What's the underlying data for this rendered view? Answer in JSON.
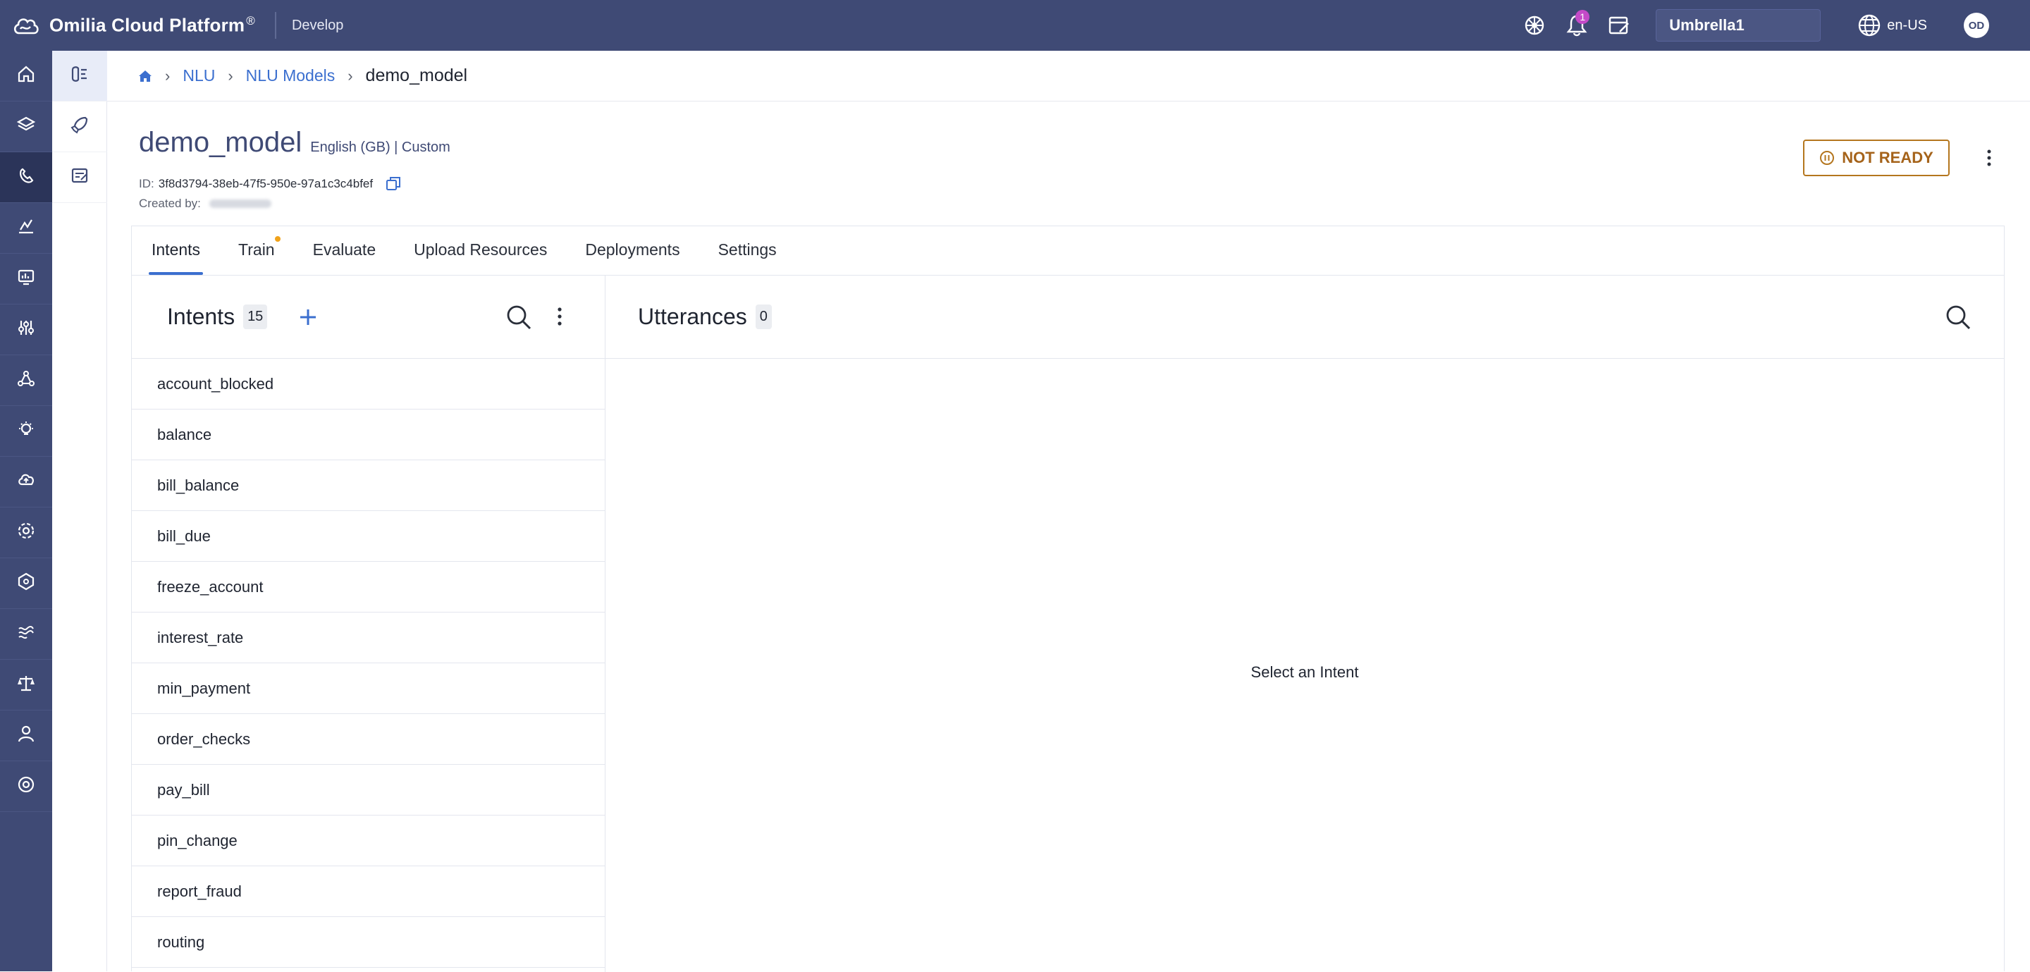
{
  "header": {
    "brand": "Omilia Cloud Platform",
    "brand_mark": "®",
    "environment": "Develop",
    "notifications_count": "1",
    "organization": "Umbrella1",
    "language": "en-US",
    "user_initials": "OD"
  },
  "nav_rail": {
    "items": [
      "home-icon",
      "layers-icon",
      "phone-icon",
      "analytics-icon",
      "monitor-icon",
      "sliders-icon",
      "network-icon",
      "lightbulb-icon",
      "cloud-icon",
      "settings-gear-icon",
      "hexagon-icon",
      "waves-icon",
      "scale-icon",
      "user-icon",
      "support-icon"
    ],
    "active_index": 2
  },
  "sub_rail": {
    "items": [
      "nlu-model-icon",
      "deploy-icon",
      "report-icon"
    ],
    "active_index": 0
  },
  "breadcrumb": {
    "home_icon": "home-icon",
    "items": [
      "NLU",
      "NLU Models"
    ],
    "current": "demo_model"
  },
  "model": {
    "name": "demo_model",
    "meta": "English (GB) | Custom",
    "id_label": "ID:",
    "id": "3f8d3794-38eb-47f5-950e-97a1c3c4bfef",
    "created_by_label": "Created by:",
    "status": "NOT READY"
  },
  "tabs": [
    {
      "label": "Intents",
      "active": true
    },
    {
      "label": "Train",
      "dot": true
    },
    {
      "label": "Evaluate"
    },
    {
      "label": "Upload Resources"
    },
    {
      "label": "Deployments"
    },
    {
      "label": "Settings"
    }
  ],
  "intents_panel": {
    "title": "Intents",
    "count": "15",
    "items": [
      "account_blocked",
      "balance",
      "bill_balance",
      "bill_due",
      "freeze_account",
      "interest_rate",
      "min_payment",
      "order_checks",
      "pay_bill",
      "pin_change",
      "report_fraud",
      "routing"
    ]
  },
  "utterances_panel": {
    "title": "Utterances",
    "count": "0",
    "empty_message": "Select an Intent"
  },
  "colors": {
    "topbar": "#3f4a75",
    "accent": "#3b6fcf",
    "status": "#b4761e",
    "badge": "#c44ac8"
  }
}
